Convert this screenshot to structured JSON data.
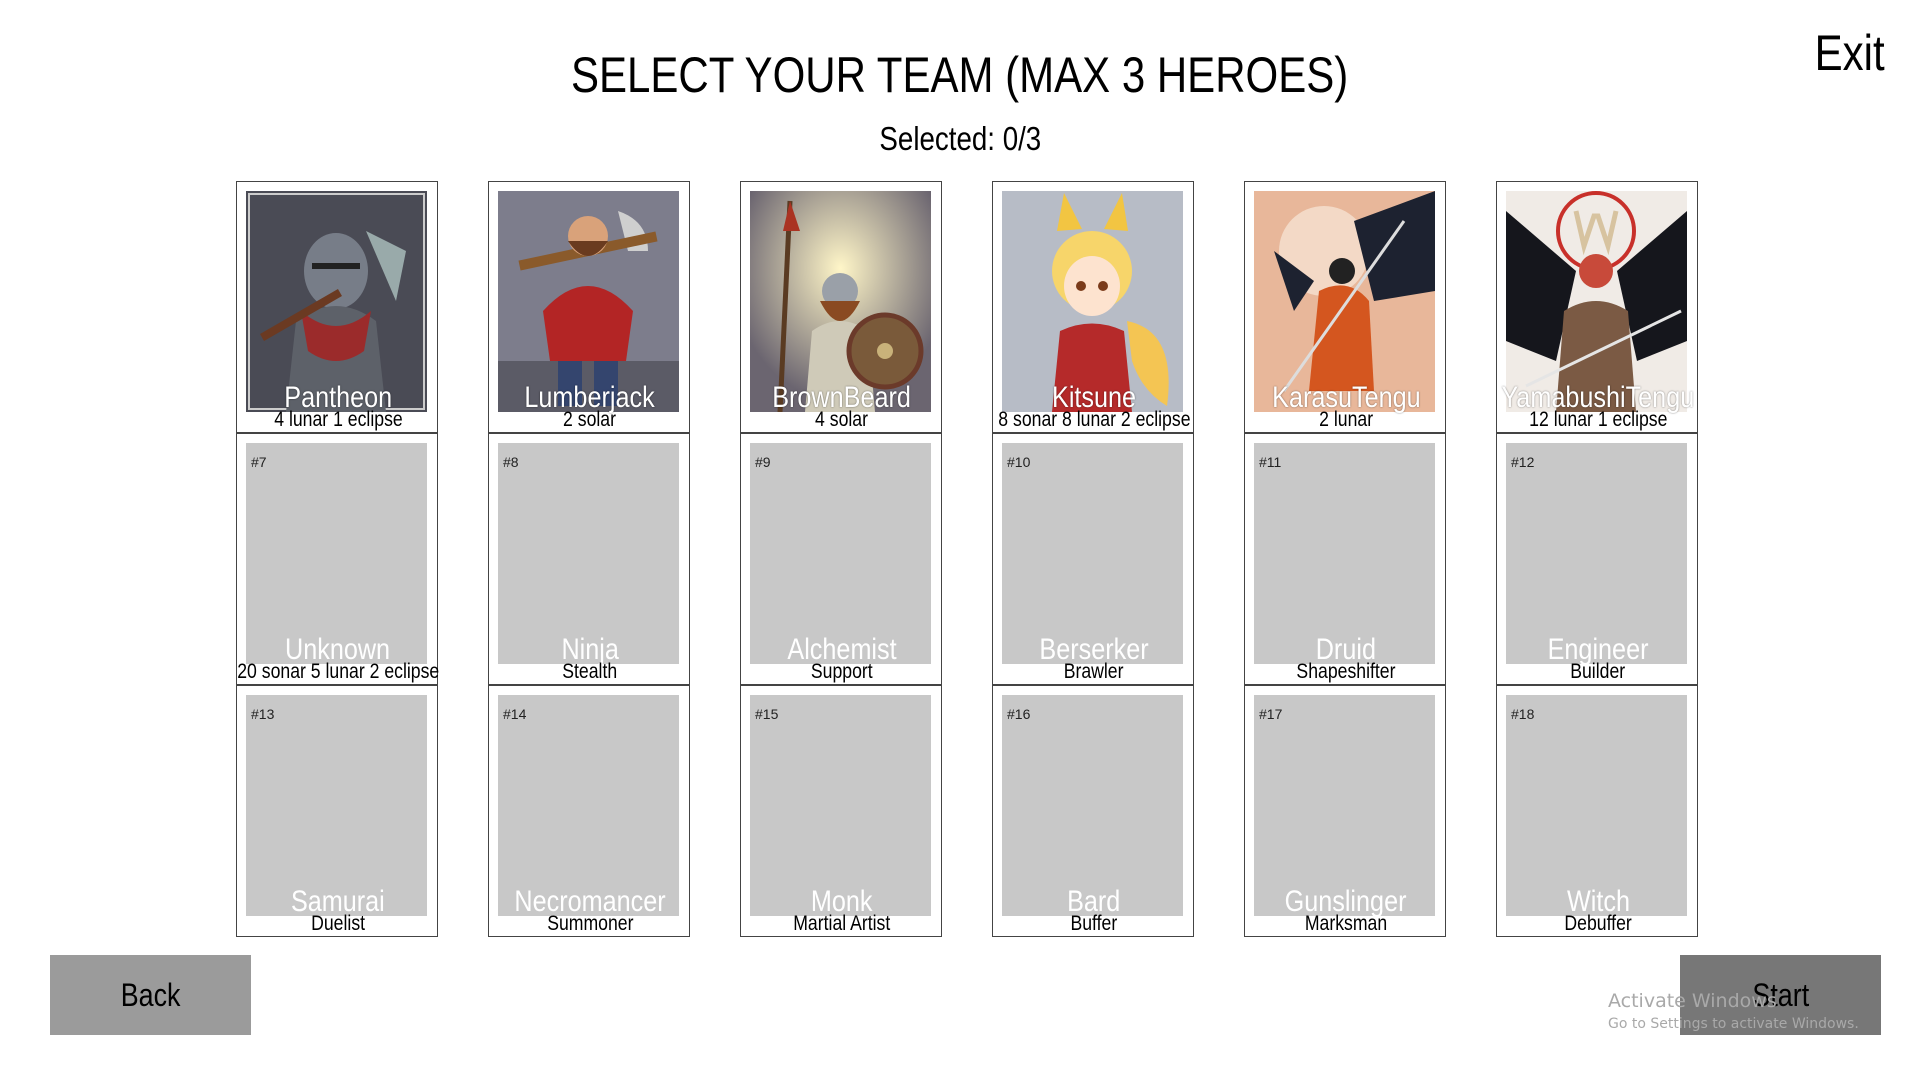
{
  "title": "SELECT YOUR TEAM (MAX 3 HEROES)",
  "selected": "Selected: 0/3",
  "exit_label": "Exit",
  "back_label": "Back",
  "start_label": "Start",
  "watermark": {
    "line1": "Activate Windows",
    "line2": "Go to Settings to activate Windows."
  },
  "heroes": [
    {
      "name": "Pantheon",
      "sub": "4 lunar 1 eclipse",
      "art": "knight-portrait"
    },
    {
      "name": "Lumberjack",
      "sub": "2 solar",
      "art": "lumberjack-portrait"
    },
    {
      "name": "BrownBeard",
      "sub": "4 solar",
      "art": "viking-portrait"
    },
    {
      "name": "Kitsune",
      "sub": "8 sonar 8 lunar 2 eclipse",
      "art": "fox-girl-portrait"
    },
    {
      "name": "KarasuTengu",
      "sub": "2 lunar",
      "art": "crow-warrior-portrait"
    },
    {
      "name": "YamabushiTengu",
      "sub": "12 lunar 1 eclipse",
      "art": "winged-samurai-portrait"
    },
    {
      "num": "#7",
      "name": "Unknown",
      "sub": "20 sonar 5 lunar 2 eclipse"
    },
    {
      "num": "#8",
      "name": "Ninja",
      "sub": "Stealth"
    },
    {
      "num": "#9",
      "name": "Alchemist",
      "sub": "Support"
    },
    {
      "num": "#10",
      "name": "Berserker",
      "sub": "Brawler"
    },
    {
      "num": "#11",
      "name": "Druid",
      "sub": "Shapeshifter"
    },
    {
      "num": "#12",
      "name": "Engineer",
      "sub": "Builder"
    },
    {
      "num": "#13",
      "name": "Samurai",
      "sub": "Duelist"
    },
    {
      "num": "#14",
      "name": "Necromancer",
      "sub": "Summoner"
    },
    {
      "num": "#15",
      "name": "Monk",
      "sub": "Martial Artist"
    },
    {
      "num": "#16",
      "name": "Bard",
      "sub": "Buffer"
    },
    {
      "num": "#17",
      "name": "Gunslinger",
      "sub": "Marksman"
    },
    {
      "num": "#18",
      "name": "Witch",
      "sub": "Debuffer"
    }
  ]
}
